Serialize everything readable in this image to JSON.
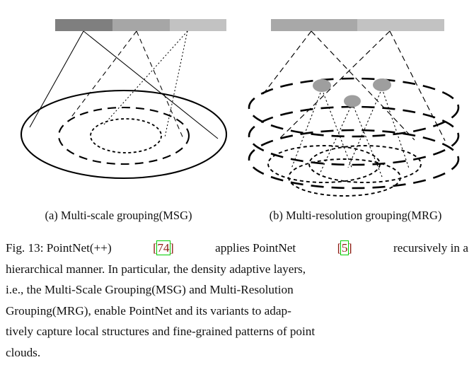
{
  "document": {
    "figure_label": "Fig. 13",
    "figure_number": "13"
  },
  "figure": {
    "subcaptions": [
      {
        "tag": "(a)",
        "label": "(a)  Multi-scale grouping(MSG)"
      },
      {
        "tag": "(b)",
        "label": "(b)  Multi-resolution grouping(MRG)"
      }
    ],
    "msg_diagram": {
      "name": "multi-scale-grouping",
      "feature_bar": {
        "segments": [
          {
            "index": 1,
            "color": "#7f7f7f"
          },
          {
            "index": 2,
            "color": "#a6a6a6"
          },
          {
            "index": 3,
            "color": "#c2c2c2"
          }
        ]
      },
      "scales": [
        {
          "index": 1,
          "style": "solid",
          "radius_label": "large"
        },
        {
          "index": 2,
          "style": "dashed",
          "radius_label": "medium"
        },
        {
          "index": 3,
          "style": "dotted",
          "radius_label": "small"
        }
      ]
    },
    "mrg_diagram": {
      "name": "multi-resolution-grouping",
      "feature_bar": {
        "segments": [
          {
            "index": 1,
            "color": "#a8a8a8"
          },
          {
            "index": 2,
            "color": "#c2c2c2"
          }
        ]
      },
      "levels": [
        {
          "index": 1,
          "style": "dashed",
          "role": "top-level-region"
        },
        {
          "index": 2,
          "style": "dashed",
          "role": "mid-level-region"
        },
        {
          "index": 3,
          "style": "dashed",
          "role": "bottom-level-region"
        }
      ],
      "centroids": [
        {
          "index": 1,
          "color": "#9e9e9e"
        },
        {
          "index": 2,
          "color": "#9e9e9e"
        },
        {
          "index": 3,
          "color": "#9e9e9e"
        }
      ],
      "local_groups": [
        {
          "index": 1,
          "style": "dotted"
        },
        {
          "index": 2,
          "style": "dotted"
        },
        {
          "index": 3,
          "style": "dotted"
        }
      ]
    }
  },
  "caption": {
    "lines": [
      {
        "justified": true,
        "parts": [
          {
            "type": "text",
            "text": "Fig. 13: PointNet(++)"
          },
          {
            "type": "cite_open",
            "text": "["
          },
          {
            "type": "cite_num",
            "text": "74"
          },
          {
            "type": "cite_close",
            "text": "]"
          },
          {
            "type": "text",
            "text": " applies PointNet "
          },
          {
            "type": "cite_open",
            "text": "["
          },
          {
            "type": "cite_num",
            "text": "5"
          },
          {
            "type": "cite_close",
            "text": "]"
          },
          {
            "type": "text",
            "text": " recursively in a"
          }
        ]
      },
      {
        "justified": false,
        "parts": [
          {
            "type": "text",
            "text": "hierarchical manner. In particular, the density adaptive layers,"
          }
        ]
      },
      {
        "justified": true,
        "parts": [
          {
            "type": "text",
            "text": "i.e.,  the  Multi-Scale  Grouping(MSG)  and  Multi-Resolution"
          }
        ]
      },
      {
        "justified": true,
        "parts": [
          {
            "type": "text",
            "text": "Grouping(MRG),  enable  PointNet  and  its  variants  to  adap-"
          }
        ]
      },
      {
        "justified": false,
        "parts": [
          {
            "type": "text",
            "text": "tively capture local structures and fine-grained patterns of point"
          }
        ]
      },
      {
        "justified": false,
        "parts": [
          {
            "type": "text",
            "text": "clouds."
          }
        ]
      }
    ],
    "full_text": "Fig. 13: PointNet(++)[74] applies PointNet [5] recursively in a hierarchical manner. In particular, the density adaptive layers, i.e., the Multi-Scale Grouping(MSG) and Multi-Resolution Grouping(MRG), enable PointNet and its variants to adaptively capture local structures and fine-grained patterns of point clouds."
  },
  "colors": {
    "citation_bracket": "#8b1a10",
    "citation_highlight_box": "#00cc00",
    "stroke": "#000000",
    "page_background": "#ffffff"
  }
}
